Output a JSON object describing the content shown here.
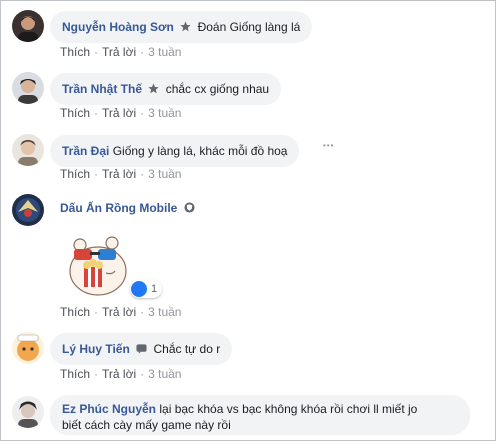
{
  "comments": [
    {
      "author": "Nguyễn Hoàng Sơn",
      "badge": "star-icon",
      "text": "Đoán Giống làng lá",
      "like": "Thích",
      "reply": "Trả lời",
      "time": "3 tuần"
    },
    {
      "author": "Trần Nhật Thế",
      "badge": "star-icon",
      "text": "chắc cx giống nhau",
      "like": "Thích",
      "reply": "Trả lời",
      "time": "3 tuần"
    },
    {
      "author": "Trần Đại",
      "text": "Giống y làng lá, khác mỗi đồ hoạ",
      "like": "Thích",
      "reply": "Trả lời",
      "time": "3 tuần",
      "more": "•••"
    },
    {
      "author": "Dấu Ấn Rồng Mobile",
      "badge": "shield-icon",
      "reaction_count": "1",
      "like": "Thích",
      "reply": "Trả lời",
      "time": "3 tuần"
    },
    {
      "author": "Lý Huy Tiến",
      "badge": "chat-icon",
      "text": "Chắc tự do r",
      "like": "Thích",
      "reply": "Trả lời",
      "time": "3 tuần"
    },
    {
      "author": "Ez Phúc Nguyễn",
      "text_line1": "lại bạc khóa vs bạc không khóa rồi chơi ll miết jo",
      "text_line2": "biết cách cày mấy game này rồi"
    }
  ],
  "separator": "·",
  "colors": {
    "author": "#385898",
    "bubble": "#f2f3f5",
    "meta": "#90949c",
    "like_blue": "#2078f4"
  }
}
